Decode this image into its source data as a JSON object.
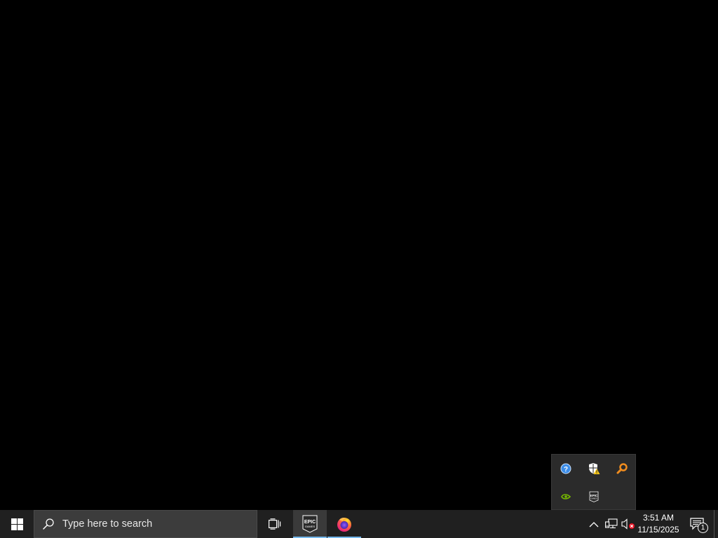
{
  "desktop": {
    "background_color": "#000000"
  },
  "taskbar": {
    "background_color": "#202020",
    "start_icon": "windows-logo-icon",
    "search": {
      "placeholder": "Type here to search",
      "icon": "search-icon"
    },
    "task_view_icon": "task-view-icon",
    "pinned_apps": [
      {
        "name": "Epic Games Launcher",
        "icon": "epic-games-icon",
        "running": true,
        "active": true
      },
      {
        "name": "Firefox",
        "icon": "firefox-icon",
        "running": true,
        "active": false
      }
    ],
    "tray": {
      "chevron_icon": "chevron-up-icon",
      "network_icon": "network-icon",
      "volume_icon": "volume-muted-icon",
      "clock": {
        "time": "3:51 AM",
        "date": "11/15/2025"
      },
      "action_center": {
        "icon": "notification-icon",
        "count": "1"
      }
    }
  },
  "tray_flyout": {
    "icons": [
      {
        "name": "help-icon",
        "color": "#3c8de8"
      },
      {
        "name": "windows-security-warning-icon",
        "color": "#f5c518"
      },
      {
        "name": "search-magnifier-orange-icon",
        "color": "#f08c1e"
      },
      {
        "name": "nvidia-icon",
        "color": "#76b900"
      },
      {
        "name": "epic-games-icon",
        "color": "#ffffff"
      }
    ]
  },
  "colors": {
    "running_indicator": "#76b9ed",
    "search_box": "#3c3c3c"
  }
}
